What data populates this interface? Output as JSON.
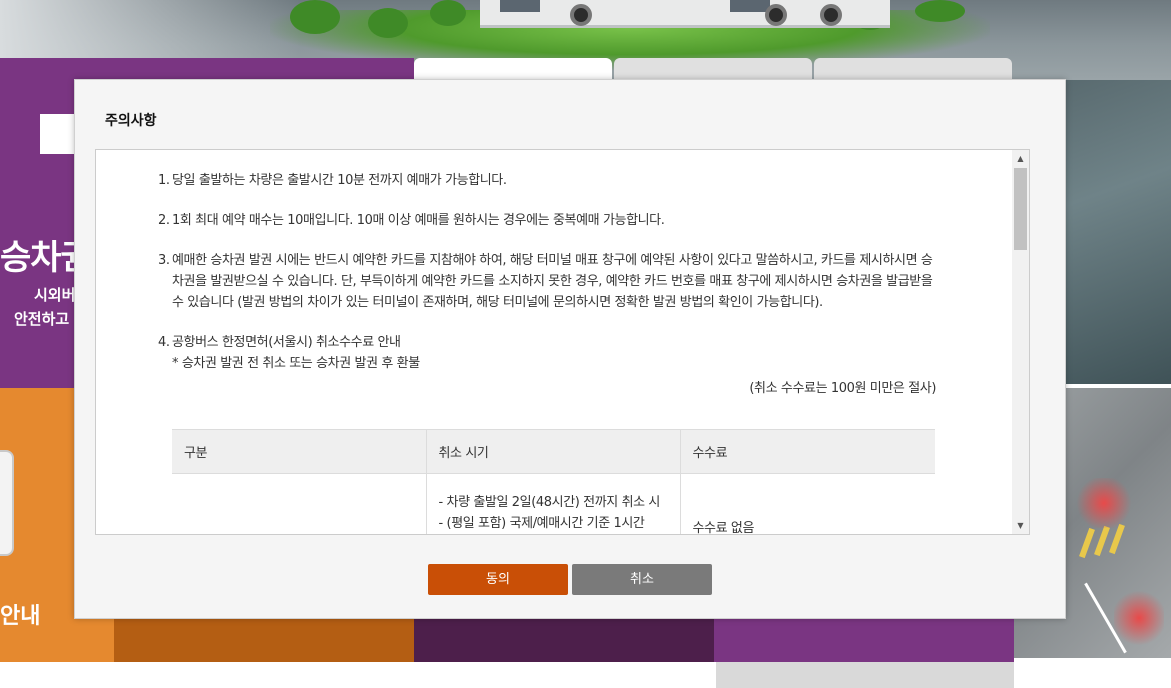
{
  "background": {
    "hero_title": "승차권",
    "hero_sub_line1": "시외버",
    "hero_sub_line2": "안전하고",
    "menu_left_label": "안내",
    "menu_labels": [
      "",
      "",
      ""
    ]
  },
  "modal": {
    "title": "주의사항",
    "notices": [
      {
        "num": "1.",
        "text": "당일 출발하는 차량은 출발시간 10분 전까지 예매가 가능합니다."
      },
      {
        "num": "2.",
        "text": "1회 최대 예약 매수는 10매입니다. 10매 이상 예매를 원하시는 경우에는 중복예매 가능합니다."
      },
      {
        "num": "3.",
        "text": "예매한 승차권 발권 시에는 반드시 예약한 카드를 지참해야 하여, 해당 터미널 매표 창구에 예약된 사항이 있다고 말씀하시고, 카드를 제시하시면 승차권을 발권받으실 수 있습니다. 단, 부득이하게 예약한 카드를 소지하지 못한 경우, 예약한 카드 번호를 매표 창구에 제시하시면 승차권을 발급받을 수 있습니다 (발권 방법의 차이가 있는 터미널이 존재하며, 해당 터미널에 문의하시면 정확한 발권 방법의 확인이 가능합니다)."
      },
      {
        "num": "4.",
        "text": "공항버스 한정면허(서울시) 취소수수료 안내",
        "sub": "* 승차권 발권 전 취소 또는 승차권 발권 후 환불"
      }
    ],
    "fee_note": "(취소 수수료는 100원 미만은 절사)",
    "table": {
      "headers": [
        "구분",
        "취소 시기",
        "수수료"
      ],
      "rows": [
        {
          "category": "",
          "timing": "- 차량 출발일 2일(48시간) 전까지 취소 시\n- (평일 포함) 국제/예매시간 기준 1시간",
          "fee": "수수료 없음"
        }
      ]
    },
    "buttons": {
      "agree": "동의",
      "cancel": "취소"
    }
  },
  "colors": {
    "agree": "#c94f06",
    "cancel": "#7a7a7a",
    "purple": "#7a3582",
    "orange": "#e5892f"
  }
}
